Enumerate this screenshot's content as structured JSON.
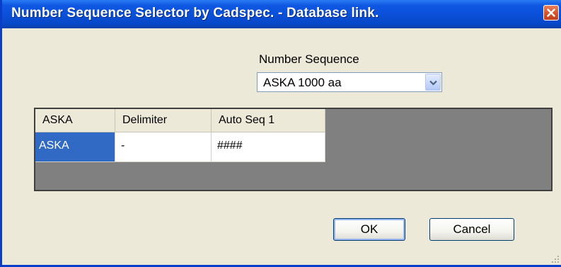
{
  "window": {
    "title": "Number Sequence Selector by Cadspec. - Database link.",
    "close_icon": "close-icon"
  },
  "number_sequence": {
    "label": "Number Sequence",
    "selected": "ASKA 1000 aa",
    "dropdown_icon": "chevron-down-icon"
  },
  "grid": {
    "columns": [
      "ASKA",
      "Delimiter",
      "Auto Seq 1"
    ],
    "rows": [
      [
        "ASKA",
        "-",
        "####"
      ]
    ],
    "selected_cell": "ASKA"
  },
  "buttons": {
    "ok": "OK",
    "cancel": "Cancel"
  },
  "colors": {
    "titlebar": "#0a4fd8",
    "selection": "#316ac5",
    "grid_background": "#808080",
    "dialog_background": "#ece9d8"
  }
}
